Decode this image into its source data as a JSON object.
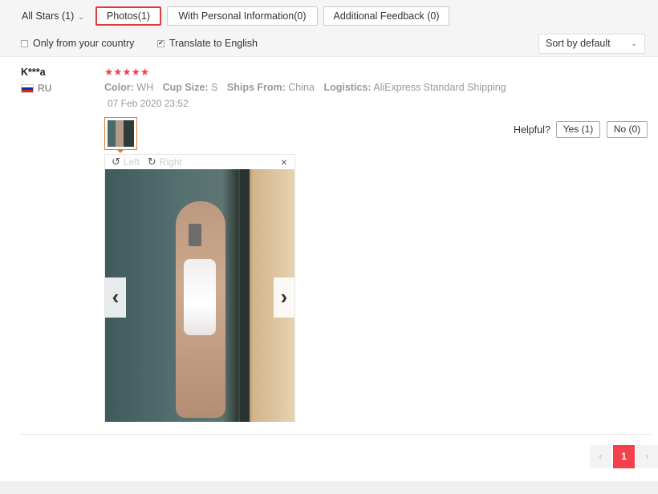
{
  "filters": {
    "all_stars": "All Stars (1)",
    "tabs": [
      {
        "label": "Photos(1)",
        "active": true
      },
      {
        "label": "With Personal Information(0)",
        "active": false
      },
      {
        "label": "Additional Feedback (0)",
        "active": false
      }
    ],
    "only_country": {
      "label": "Only from your country",
      "checked": false
    },
    "translate": {
      "label": "Translate to English",
      "checked": true
    },
    "sort": {
      "value": "Sort by default"
    }
  },
  "review": {
    "user": "K***a",
    "country": "RU",
    "stars": "★★★★★",
    "attributes": [
      {
        "key": "Color:",
        "value": "WH"
      },
      {
        "key": "Cup Size:",
        "value": "S"
      },
      {
        "key": "Ships From:",
        "value": "China"
      },
      {
        "key": "Logistics:",
        "value": "AliExpress Standard Shipping"
      }
    ],
    "date": "07 Feb 2020 23:52",
    "helpful": {
      "label": "Helpful?",
      "yes": "Yes (1)",
      "no": "No (0)"
    },
    "viewer": {
      "rotate_left": "Left",
      "rotate_right": "Right"
    }
  },
  "pagination": {
    "current": "1",
    "prev": "‹",
    "next": "›"
  },
  "colors": {
    "accent": "#f2414c",
    "active_border": "#e0393e",
    "thumb_border": "#e47e2c"
  }
}
